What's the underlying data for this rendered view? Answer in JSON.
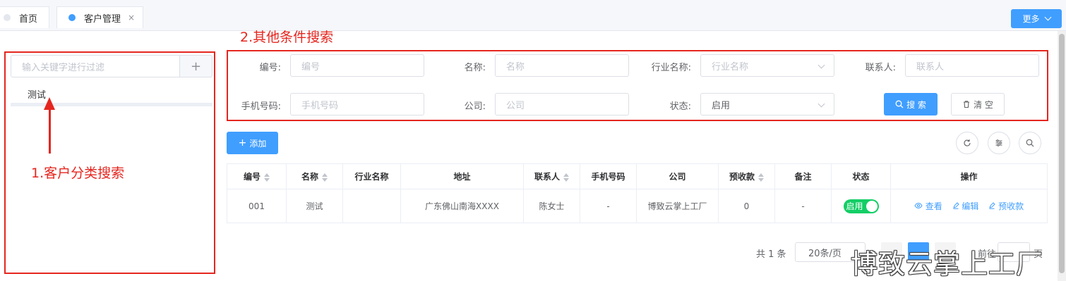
{
  "tabs": {
    "home": "首页",
    "customer": "客户管理",
    "close": "×",
    "more": "更多"
  },
  "annotations": {
    "category_search": "1.客户分类搜索",
    "other_search": "2.其他条件搜索"
  },
  "category_pane": {
    "filter_placeholder": "输入关键字进行过滤",
    "add_symbol": "+",
    "items": [
      "测试"
    ]
  },
  "search_form": {
    "fields": [
      {
        "label": "编号:",
        "placeholder": "编号"
      },
      {
        "label": "名称:",
        "placeholder": "名称"
      },
      {
        "label": "行业名称:",
        "placeholder": "行业名称"
      },
      {
        "label": "联系人:",
        "placeholder": "联系人"
      },
      {
        "label": "手机号码:",
        "placeholder": "手机号码"
      },
      {
        "label": "公司:",
        "placeholder": "公司"
      },
      {
        "label": "状态:",
        "value": "启用"
      }
    ],
    "search_button": "搜 索",
    "clear_button": "清 空"
  },
  "toolbar": {
    "add_button": "添加",
    "add_symbol": "+"
  },
  "table": {
    "columns": [
      "编号",
      "名称",
      "行业名称",
      "地址",
      "联系人",
      "手机号码",
      "公司",
      "预收款",
      "备注",
      "状态",
      "操作"
    ],
    "rows": [
      {
        "code": "001",
        "name": "测试",
        "industry": "",
        "address": "广东佛山南海XXXX",
        "contact": "陈女士",
        "phone": "-",
        "company": "博致云掌上工厂",
        "prepayment": "0",
        "remark": "-",
        "status": "启用",
        "ops": {
          "view": "查看",
          "edit": "编辑",
          "prepay": "预收款"
        }
      }
    ]
  },
  "pagination": {
    "total": "共 1 条",
    "page_size": "20条/页",
    "goto": "前往",
    "page_suffix": "页"
  },
  "watermark": "博致云掌上工厂",
  "colors": {
    "primary": "#409eff",
    "annotation": "#e5261f",
    "switch_on": "#13ce66"
  }
}
